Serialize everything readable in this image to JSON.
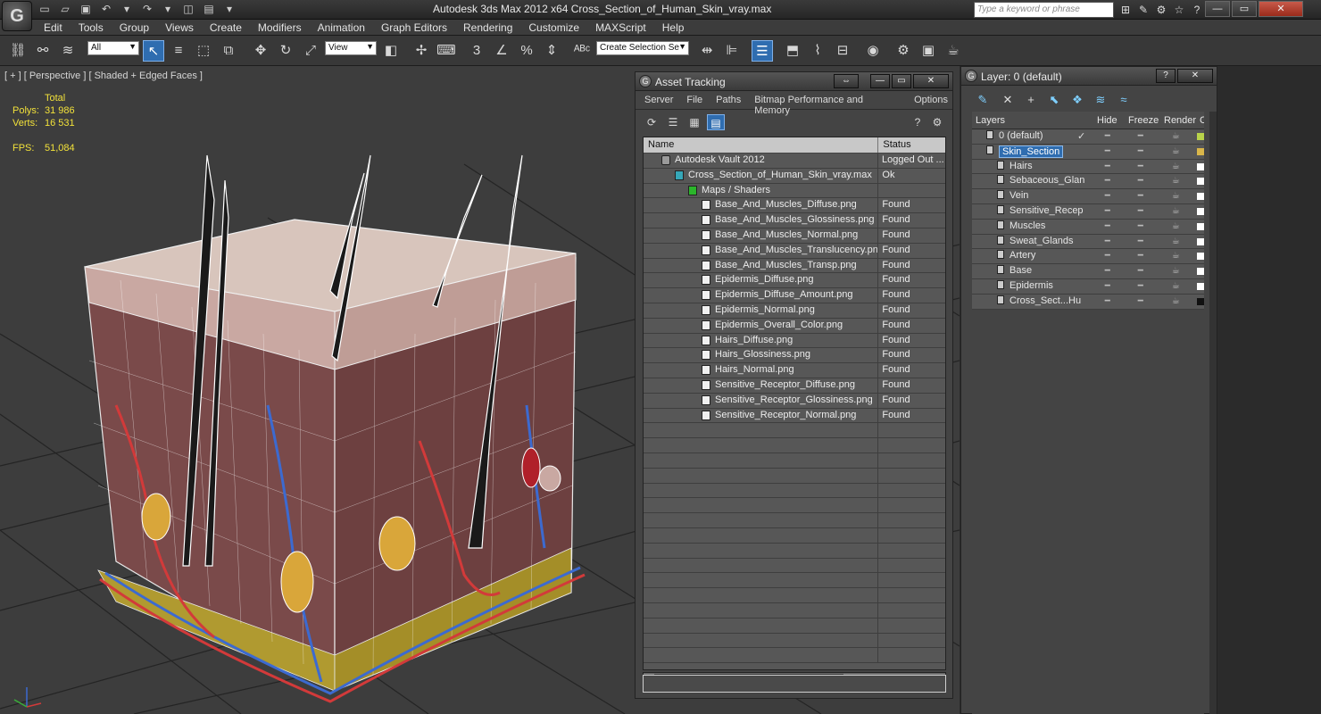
{
  "window": {
    "title": "Autodesk 3ds Max  2012 x64       Cross_Section_of_Human_Skin_vray.max",
    "search_placeholder": "Type a keyword or phrase"
  },
  "menu": [
    "Edit",
    "Tools",
    "Group",
    "Views",
    "Create",
    "Modifiers",
    "Animation",
    "Graph Editors",
    "Rendering",
    "Customize",
    "MAXScript",
    "Help"
  ],
  "toolbar": {
    "selection_filter": "All",
    "ref_coord": "View",
    "named_selection": "Create Selection Se"
  },
  "viewport": {
    "label": "[ + ] [ Perspective ] [ Shaded + Edged Faces ]",
    "stats": {
      "header": "Total",
      "polys_label": "Polys:",
      "polys_value": "31 986",
      "verts_label": "Verts:",
      "verts_value": "16 531",
      "fps_label": "FPS:",
      "fps_value": "51,084"
    }
  },
  "asset_tracking": {
    "title": "Asset Tracking",
    "menu": [
      "Server",
      "File",
      "Paths",
      "Bitmap Performance and Memory",
      "Options"
    ],
    "columns": {
      "name": "Name",
      "status": "Status"
    },
    "rows": [
      {
        "name": "Autodesk Vault 2012",
        "status": "Logged Out ...",
        "icon": "vault-icon",
        "indent": 0
      },
      {
        "name": "Cross_Section_of_Human_Skin_vray.max",
        "status": "Ok",
        "icon": "max-file-icon",
        "indent": 1
      },
      {
        "name": "Maps / Shaders",
        "status": "",
        "icon": "folder-icon",
        "indent": 2
      },
      {
        "name": "Base_And_Muscles_Diffuse.png",
        "status": "Found",
        "icon": "map-file-icon",
        "indent": 3
      },
      {
        "name": "Base_And_Muscles_Glossiness.png",
        "status": "Found",
        "icon": "map-file-icon",
        "indent": 3
      },
      {
        "name": "Base_And_Muscles_Normal.png",
        "status": "Found",
        "icon": "map-file-icon",
        "indent": 3
      },
      {
        "name": "Base_And_Muscles_Translucency.png",
        "status": "Found",
        "icon": "map-file-icon",
        "indent": 3
      },
      {
        "name": "Base_And_Muscles_Transp.png",
        "status": "Found",
        "icon": "map-file-icon",
        "indent": 3
      },
      {
        "name": "Epidermis_Diffuse.png",
        "status": "Found",
        "icon": "map-file-icon",
        "indent": 3
      },
      {
        "name": "Epidermis_Diffuse_Amount.png",
        "status": "Found",
        "icon": "map-file-icon",
        "indent": 3
      },
      {
        "name": "Epidermis_Normal.png",
        "status": "Found",
        "icon": "map-file-icon",
        "indent": 3
      },
      {
        "name": "Epidermis_Overall_Color.png",
        "status": "Found",
        "icon": "map-file-icon",
        "indent": 3
      },
      {
        "name": "Hairs_Diffuse.png",
        "status": "Found",
        "icon": "map-file-icon",
        "indent": 3
      },
      {
        "name": "Hairs_Glossiness.png",
        "status": "Found",
        "icon": "map-file-icon",
        "indent": 3
      },
      {
        "name": "Hairs_Normal.png",
        "status": "Found",
        "icon": "map-file-icon",
        "indent": 3
      },
      {
        "name": "Sensitive_Receptor_Diffuse.png",
        "status": "Found",
        "icon": "map-file-icon",
        "indent": 3
      },
      {
        "name": "Sensitive_Receptor_Glossiness.png",
        "status": "Found",
        "icon": "map-file-icon",
        "indent": 3
      },
      {
        "name": "Sensitive_Receptor_Normal.png",
        "status": "Found",
        "icon": "map-file-icon",
        "indent": 3
      }
    ],
    "empty_rows": 16
  },
  "layer_panel": {
    "title": "Layer: 0 (default)",
    "columns": [
      "Layers",
      "Hide",
      "Freeze",
      "Render",
      "Co"
    ],
    "rows": [
      {
        "name": "0 (default)",
        "indent": 1,
        "type": "layer",
        "check": "✓",
        "swatch": "#b8d34a"
      },
      {
        "name": "Skin_Section",
        "indent": 1,
        "type": "layer",
        "selected": true,
        "swatch": "#d9b64a"
      },
      {
        "name": "Hairs",
        "indent": 2,
        "type": "object",
        "swatch": "#ffffff"
      },
      {
        "name": "Sebaceous_Glan",
        "indent": 2,
        "type": "object",
        "swatch": "#ffffff"
      },
      {
        "name": "Vein",
        "indent": 2,
        "type": "object",
        "swatch": "#ffffff"
      },
      {
        "name": "Sensitive_Recep",
        "indent": 2,
        "type": "object",
        "swatch": "#ffffff"
      },
      {
        "name": "Muscles",
        "indent": 2,
        "type": "object",
        "swatch": "#ffffff"
      },
      {
        "name": "Sweat_Glands",
        "indent": 2,
        "type": "object",
        "swatch": "#ffffff"
      },
      {
        "name": "Artery",
        "indent": 2,
        "type": "object",
        "swatch": "#ffffff"
      },
      {
        "name": "Base",
        "indent": 2,
        "type": "object",
        "swatch": "#ffffff"
      },
      {
        "name": "Epidermis",
        "indent": 2,
        "type": "object",
        "swatch": "#ffffff"
      },
      {
        "name": "Cross_Sect...Hu",
        "indent": 2,
        "type": "object",
        "swatch": "#111111"
      }
    ]
  }
}
